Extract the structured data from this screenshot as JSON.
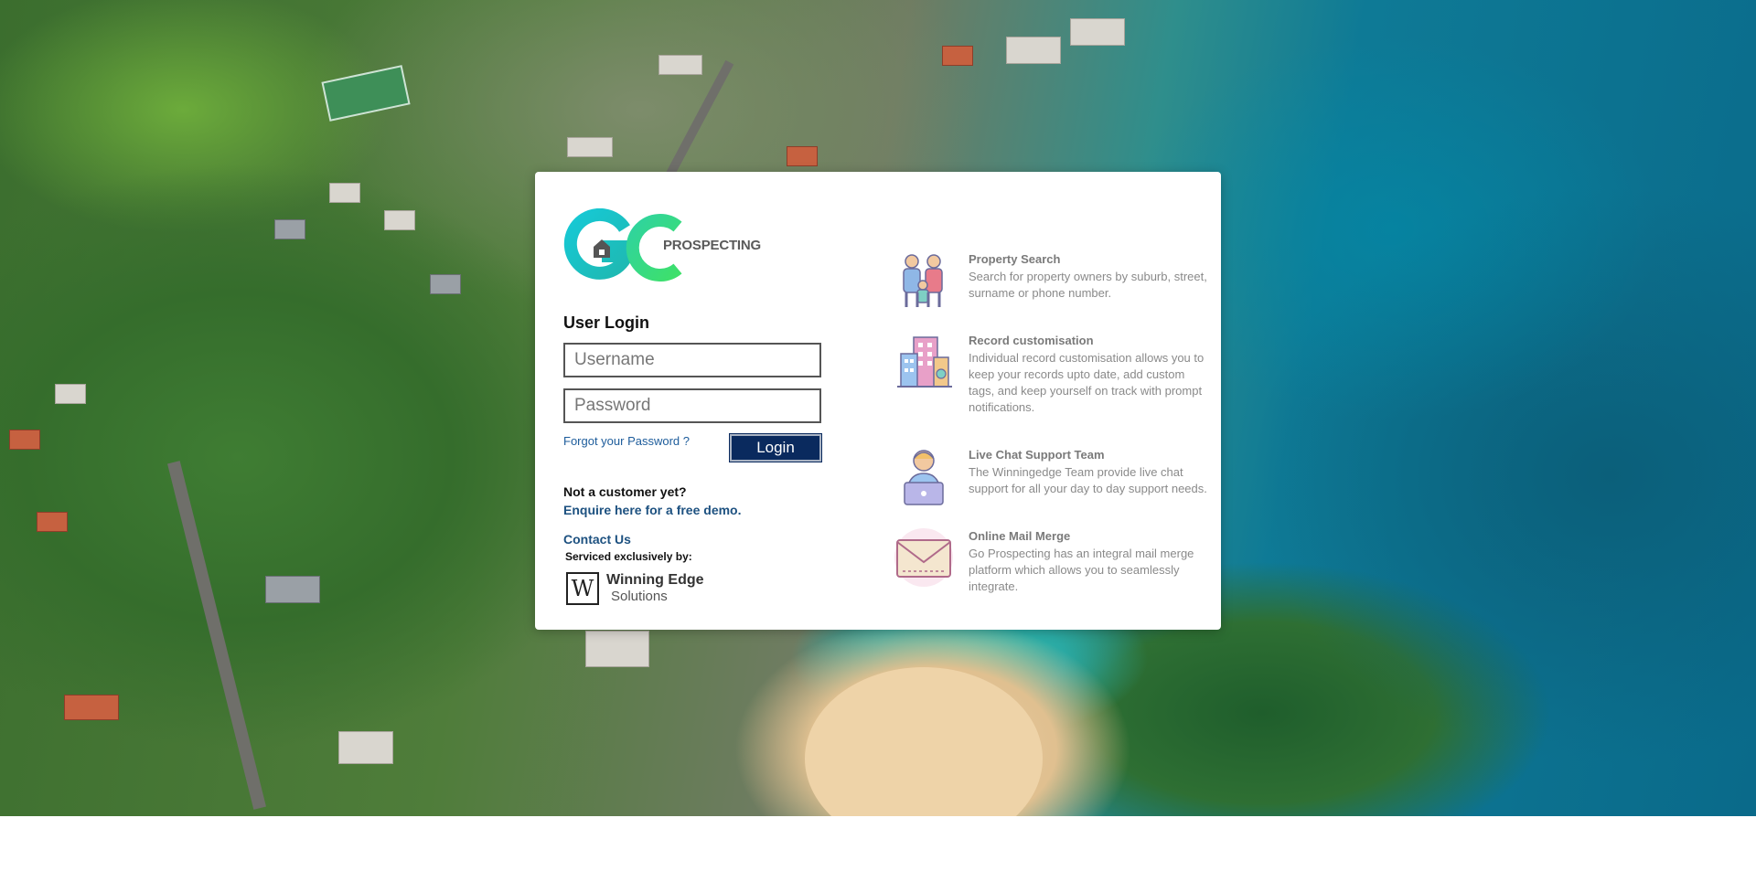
{
  "brand": {
    "logo_text": "PROSPECTING",
    "logo_colors": {
      "primary": "#1cc6c4",
      "secondary": "#25d366"
    }
  },
  "login": {
    "title": "User Login",
    "username_placeholder": "Username",
    "password_placeholder": "Password",
    "forgot_label": "Forgot your Password ?",
    "login_button": "Login"
  },
  "signup": {
    "not_customer": "Not a customer yet?",
    "enquire_link": "Enquire here for a free demo.",
    "contact_link": "Contact Us",
    "serviced_by": "Serviced exclusively by:",
    "partner_mark": "W",
    "partner_name_line1": "Winning Edge",
    "partner_name_line2": "Solutions"
  },
  "features": [
    {
      "icon": "people-icon",
      "title": "Property Search",
      "description": "Search for property owners by suburb, street, surname or phone number."
    },
    {
      "icon": "building-icon",
      "title": "Record customisation",
      "description": "Individual record customisation allows you to keep your records upto date, add custom tags, and keep yourself on track with prompt notifications."
    },
    {
      "icon": "support-agent-icon",
      "title": "Live Chat Support Team",
      "description": "The Winningedge Team provide live chat support for all your day to day support needs."
    },
    {
      "icon": "mail-envelope-icon",
      "title": "Online Mail Merge",
      "description": "Go Prospecting has an integral mail merge platform which allows you to seamlessly integrate."
    }
  ],
  "colors": {
    "login_button_bg": "#0a2a5e",
    "link": "#1d5c9b",
    "feature_text": "#8a8a8a"
  }
}
